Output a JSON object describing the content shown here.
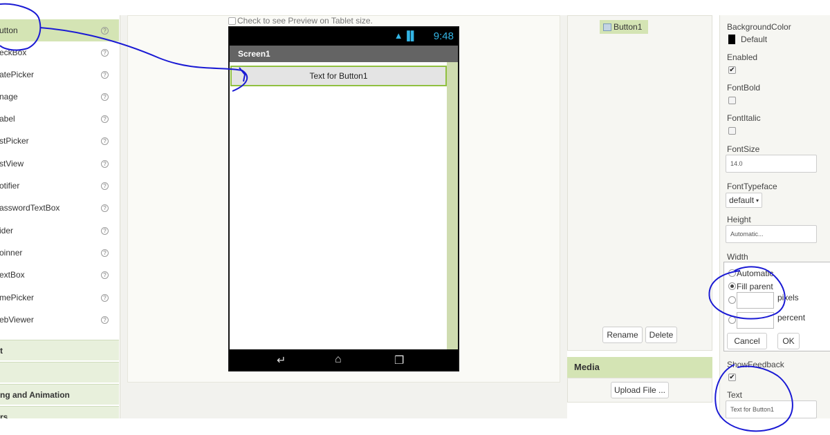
{
  "palette": {
    "items": [
      {
        "label": "utton"
      },
      {
        "label": "eckBox"
      },
      {
        "label": "atePicker"
      },
      {
        "label": "nage"
      },
      {
        "label": "abel"
      },
      {
        "label": "stPicker"
      },
      {
        "label": "stView"
      },
      {
        "label": "otifier"
      },
      {
        "label": "asswordTextBox"
      },
      {
        "label": "ider"
      },
      {
        "label": "oinner"
      },
      {
        "label": "extBox"
      },
      {
        "label": "mePicker"
      },
      {
        "label": "ebViewer"
      }
    ],
    "help_glyph": "?",
    "categories": [
      {
        "label": "t"
      },
      {
        "label": ""
      },
      {
        "label": "ng and Animation"
      },
      {
        "label": "rs"
      }
    ]
  },
  "viewer": {
    "tablet_preview_label": "Check to see Preview on Tablet size.",
    "status_time": "9:48",
    "screen_title": "Screen1",
    "button_text": "Text for Button1"
  },
  "components": {
    "selected": "Button1",
    "rename_label": "Rename",
    "delete_label": "Delete"
  },
  "media": {
    "title": "Media",
    "upload_label": "Upload File ..."
  },
  "properties": {
    "background_color_label": "BackgroundColor",
    "background_color_value": "Default",
    "enabled_label": "Enabled",
    "fontbold_label": "FontBold",
    "fontitalic_label": "FontItalic",
    "fontsize_label": "FontSize",
    "fontsize_value": "14.0",
    "fonttypeface_label": "FontTypeface",
    "fonttypeface_value": "default",
    "height_label": "Height",
    "height_value": "Automatic...",
    "width_label": "Width",
    "width_options": {
      "automatic": "Automatic",
      "fill_parent": "Fill parent",
      "pixels": "pixels",
      "percent": "percent"
    },
    "cancel_label": "Cancel",
    "ok_label": "OK",
    "show_feedback_label": "ShowFeedback",
    "text_label": "Text",
    "text_value": "Text for Button1"
  },
  "colors": {
    "accent_green": "#d4e4b4",
    "button_border": "#90c040",
    "annotation_ink": "#1a1ad4"
  }
}
